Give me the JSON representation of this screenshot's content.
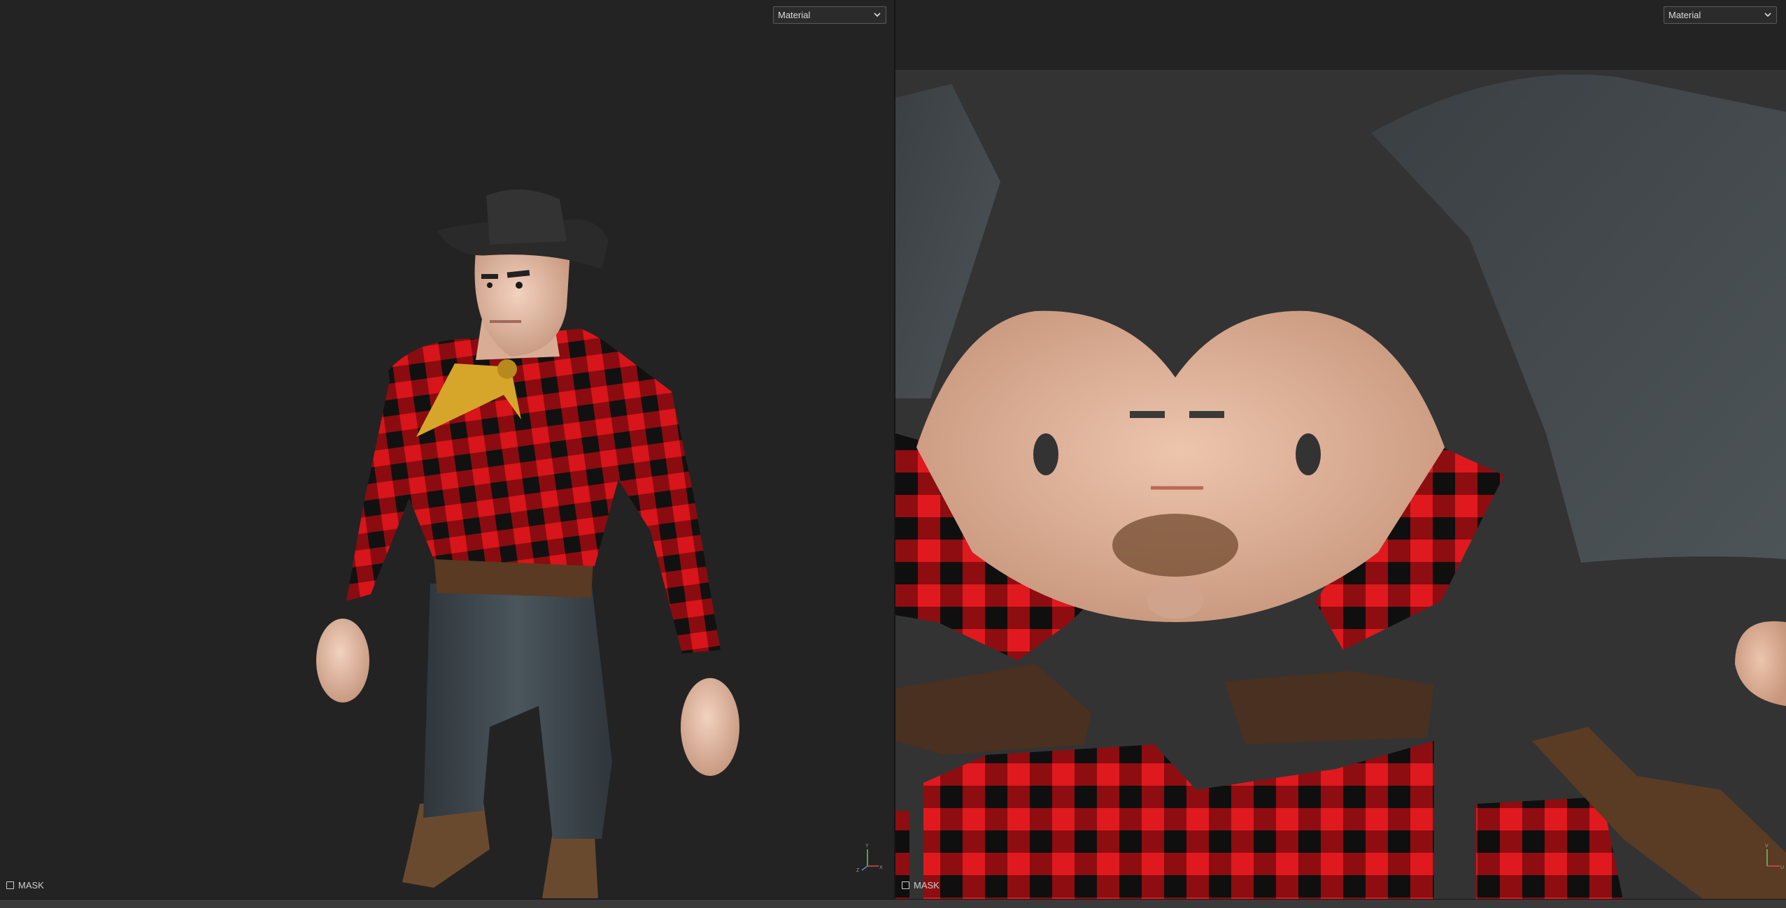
{
  "viewport_3d": {
    "material_dropdown": {
      "selected": "Material"
    },
    "mask_label": "MASK",
    "axis": {
      "y": "Y",
      "x": "X",
      "z": "Z"
    }
  },
  "viewport_2d": {
    "material_dropdown": {
      "selected": "Material"
    },
    "mask_label": "MASK",
    "axis": {
      "v": "V",
      "u": "U"
    }
  },
  "colors": {
    "background": "#232323",
    "uv_background": "#333333",
    "plaid_red": "#d8151a",
    "plaid_black": "#111111",
    "skin": "#e8c0a8",
    "denim": "#3a4349",
    "leather": "#5a3a22",
    "hat": "#2a2a2a",
    "bandana": "#d6a62a"
  }
}
